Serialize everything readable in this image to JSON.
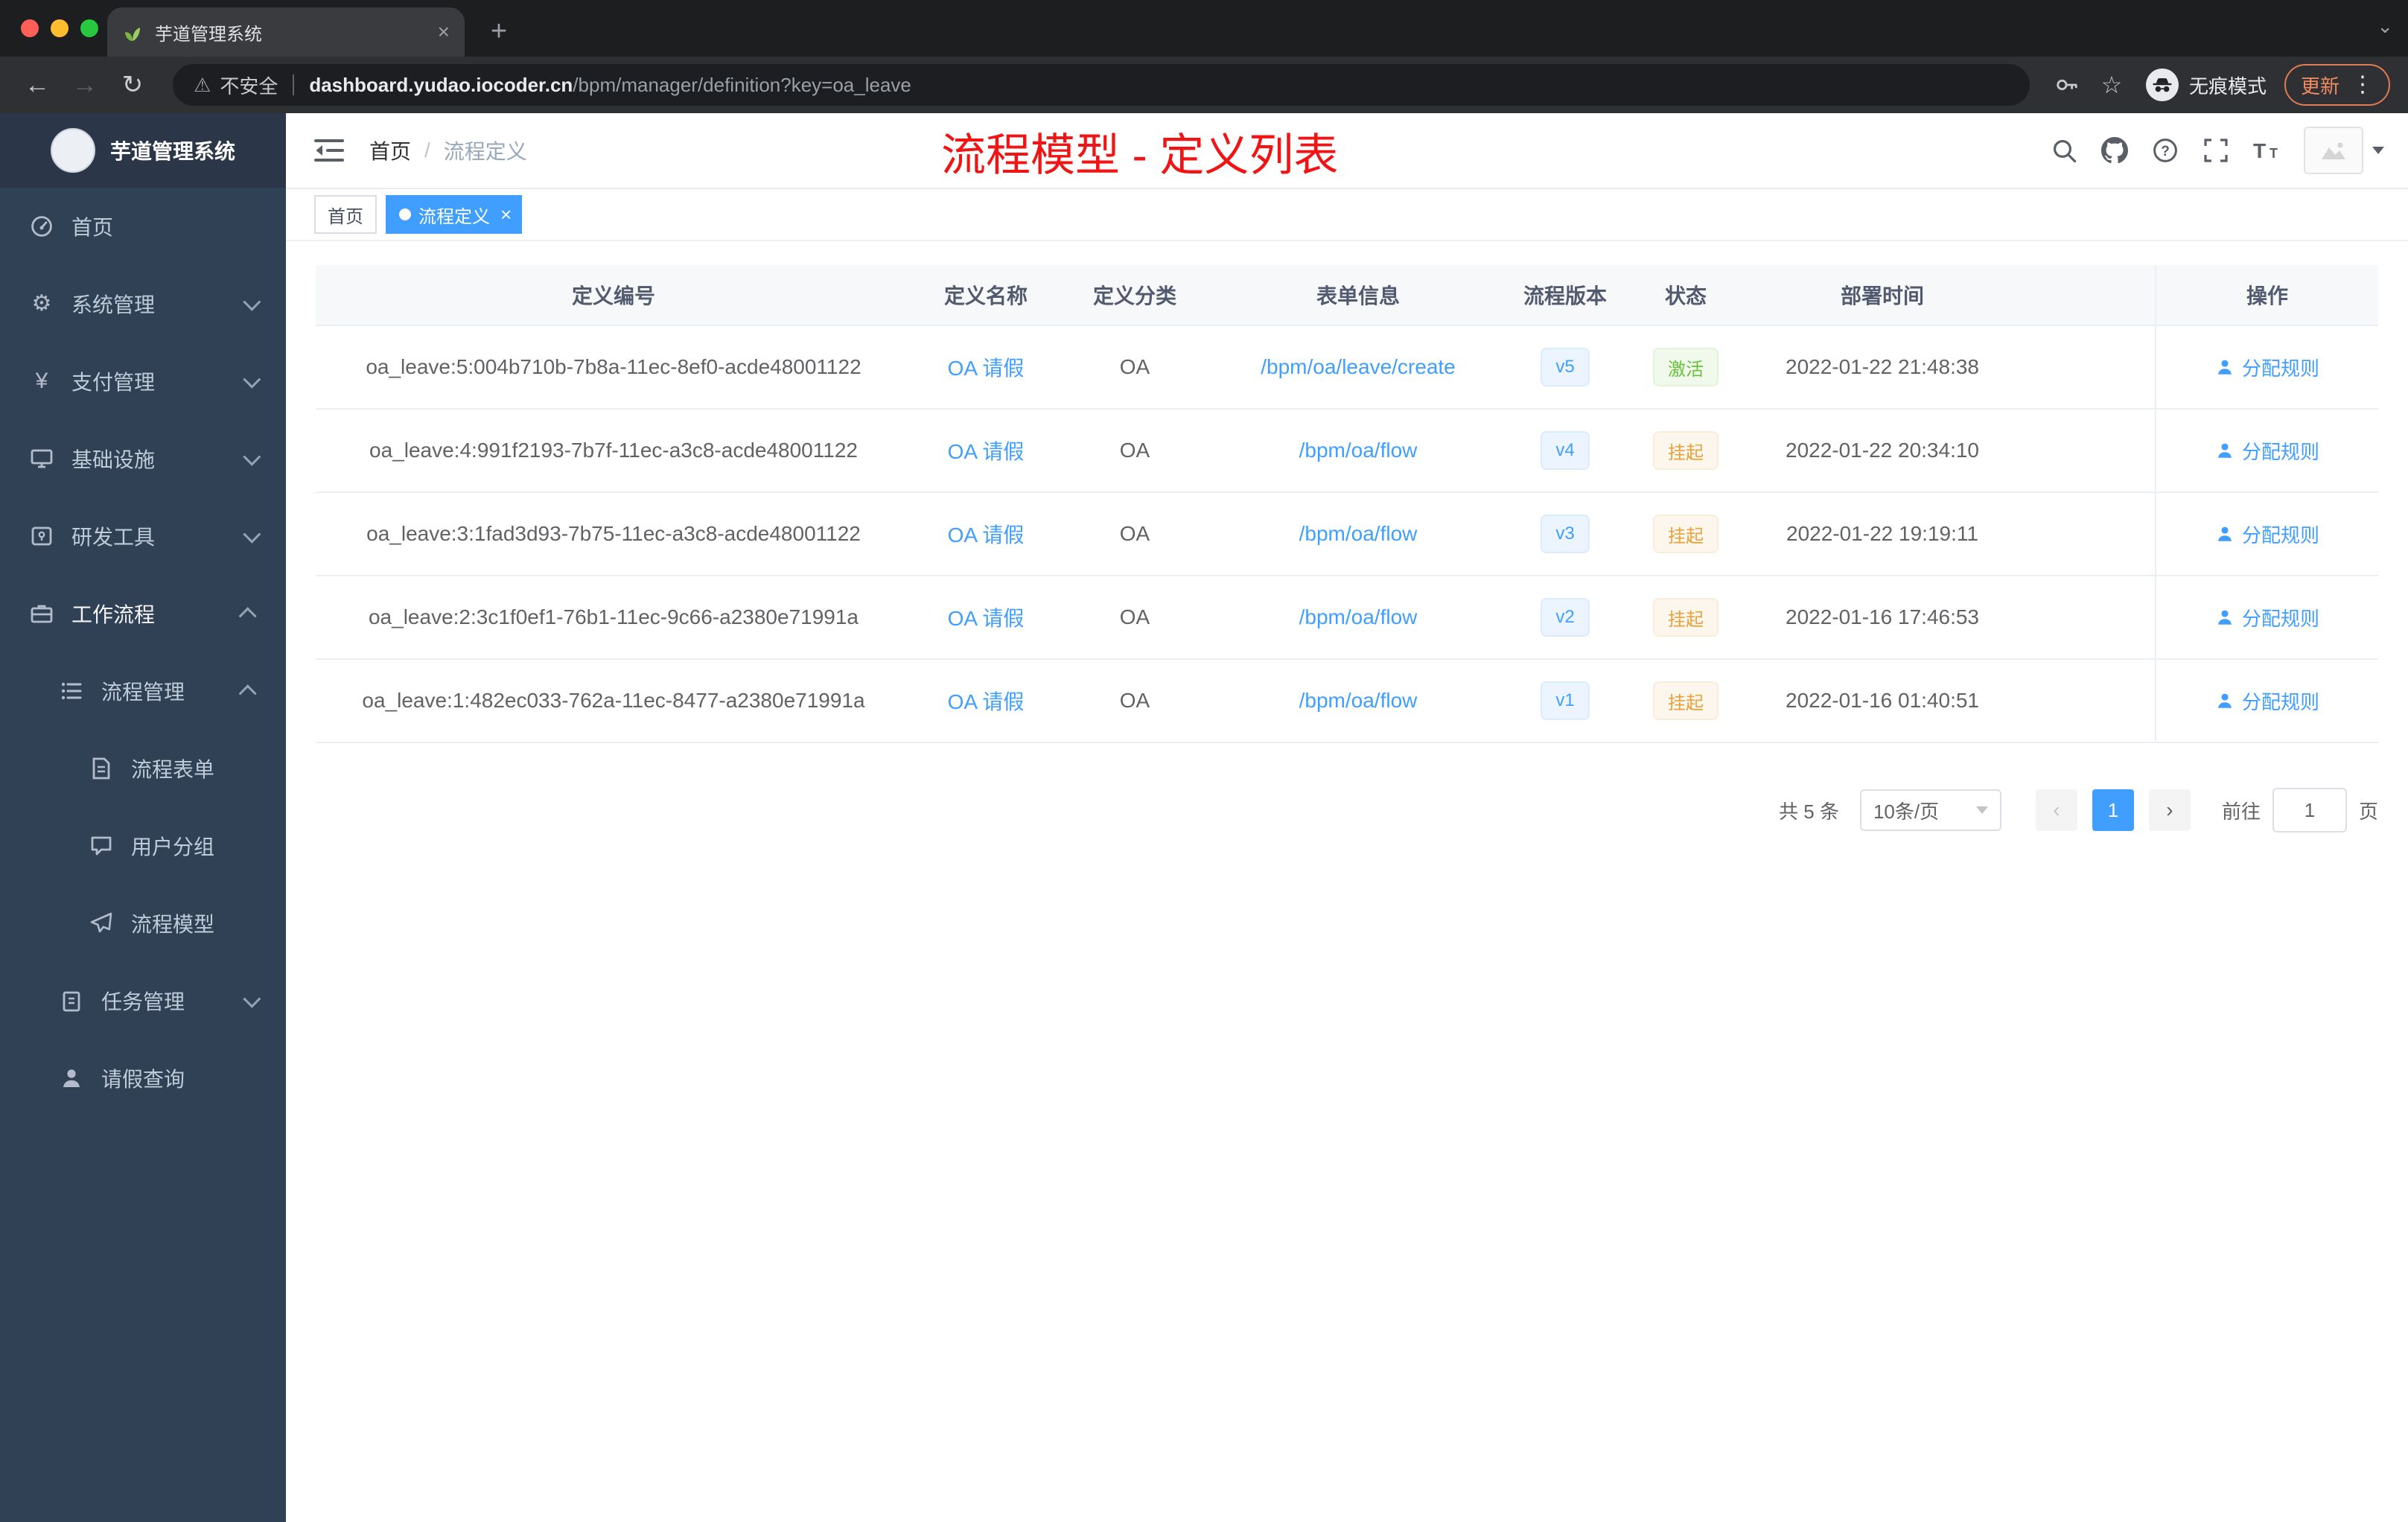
{
  "browser": {
    "tab": {
      "title": "芋道管理系统"
    },
    "security_label": "不安全",
    "url_domain": "dashboard.yudao.iocoder.cn",
    "url_path": "/bpm/manager/definition?key=oa_leave",
    "incognito_label": "无痕模式",
    "update_label": "更新"
  },
  "sidebar": {
    "logo_title": "芋道管理系统",
    "menu": [
      {
        "label": "首页"
      },
      {
        "label": "系统管理"
      },
      {
        "label": "支付管理"
      },
      {
        "label": "基础设施"
      },
      {
        "label": "研发工具"
      },
      {
        "label": "工作流程"
      },
      {
        "label": "流程管理"
      },
      {
        "label": "流程表单"
      },
      {
        "label": "用户分组"
      },
      {
        "label": "流程模型"
      },
      {
        "label": "任务管理"
      },
      {
        "label": "请假查询"
      }
    ]
  },
  "navbar": {
    "breadcrumb": [
      "首页",
      "流程定义"
    ],
    "breadcrumb_separator": "/",
    "overlay_title": "流程模型 - 定义列表"
  },
  "tags": [
    {
      "label": "首页"
    },
    {
      "label": "流程定义"
    }
  ],
  "table": {
    "headers": [
      "定义编号",
      "定义名称",
      "定义分类",
      "表单信息",
      "流程版本",
      "状态",
      "部署时间",
      "操作"
    ],
    "action_label": "分配规则",
    "rows": [
      {
        "id": "oa_leave:5:004b710b-7b8a-11ec-8ef0-acde48001122",
        "name": "OA 请假",
        "category": "OA",
        "form": "/bpm/oa/leave/create",
        "version": "v5",
        "status": "激活",
        "time": "2022-01-22 21:48:38"
      },
      {
        "id": "oa_leave:4:991f2193-7b7f-11ec-a3c8-acde48001122",
        "name": "OA 请假",
        "category": "OA",
        "form": "/bpm/oa/flow",
        "version": "v4",
        "status": "挂起",
        "time": "2022-01-22 20:34:10"
      },
      {
        "id": "oa_leave:3:1fad3d93-7b75-11ec-a3c8-acde48001122",
        "name": "OA 请假",
        "category": "OA",
        "form": "/bpm/oa/flow",
        "version": "v3",
        "status": "挂起",
        "time": "2022-01-22 19:19:11"
      },
      {
        "id": "oa_leave:2:3c1f0ef1-76b1-11ec-9c66-a2380e71991a",
        "name": "OA 请假",
        "category": "OA",
        "form": "/bpm/oa/flow",
        "version": "v2",
        "status": "挂起",
        "time": "2022-01-16 17:46:53"
      },
      {
        "id": "oa_leave:1:482ec033-762a-11ec-8477-a2380e71991a",
        "name": "OA 请假",
        "category": "OA",
        "form": "/bpm/oa/flow",
        "version": "v1",
        "status": "挂起",
        "time": "2022-01-16 01:40:51"
      }
    ]
  },
  "pagination": {
    "total": "共 5 条",
    "page_size": "10条/页",
    "current_page": "1",
    "goto_prefix": "前往",
    "goto_value": "1",
    "goto_suffix": "页"
  },
  "colors": {
    "accent": "#409eff",
    "sidebar_bg": "#304156",
    "success": "#67c23a",
    "warning": "#e6a23c",
    "title_red": "#f11414"
  }
}
